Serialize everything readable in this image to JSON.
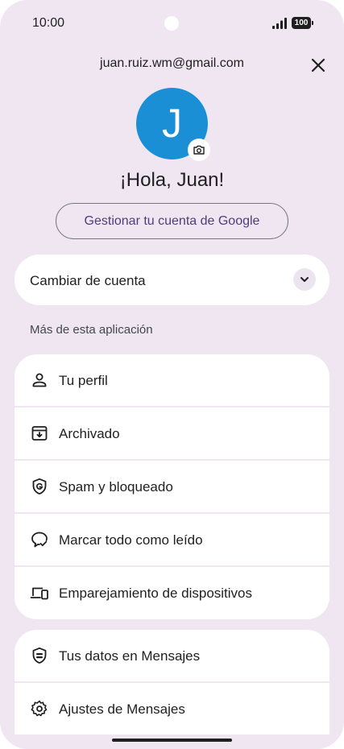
{
  "status_bar": {
    "time": "10:00",
    "battery": "100"
  },
  "header": {
    "email": "juan.ruiz.wm@gmail.com",
    "avatar_initial": "J",
    "greeting": "¡Hola, Juan!",
    "manage_account_label": "Gestionar tu cuenta de Google"
  },
  "switch_account": {
    "label": "Cambiar de cuenta"
  },
  "section": {
    "label": "Más de esta aplicación"
  },
  "menu_group_1": [
    {
      "label": "Tu perfil",
      "icon": "person-icon"
    },
    {
      "label": "Archivado",
      "icon": "archive-icon"
    },
    {
      "label": "Spam y bloqueado",
      "icon": "spam-shield-icon"
    },
    {
      "label": "Marcar todo como leído",
      "icon": "mark-read-icon"
    },
    {
      "label": "Emparejamiento de dispositivos",
      "icon": "devices-icon"
    }
  ],
  "menu_group_2": [
    {
      "label": "Tus datos en Mensajes",
      "icon": "privacy-shield-icon"
    },
    {
      "label": "Ajustes de Mensajes",
      "icon": "gear-icon"
    }
  ],
  "colors": {
    "background": "#efe6f2",
    "avatar": "#1a8fd6",
    "accent_text": "#4b3f7a"
  }
}
